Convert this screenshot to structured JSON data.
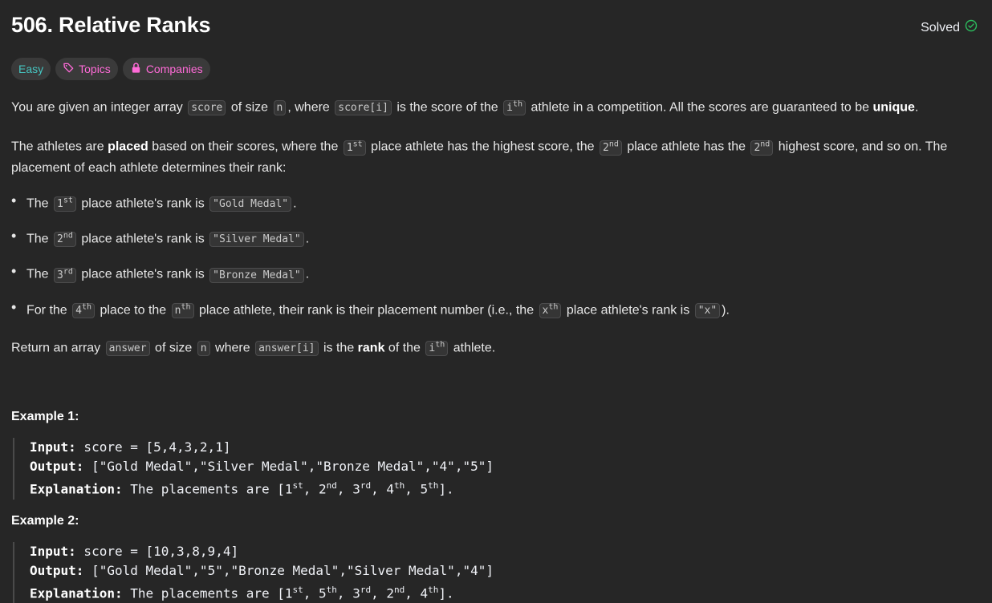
{
  "problem": {
    "title": "506. Relative Ranks",
    "status": "Solved"
  },
  "tags": {
    "difficulty": "Easy",
    "topics": "Topics",
    "companies": "Companies"
  },
  "description": {
    "p1": {
      "a": "You are given an integer array",
      "code1": "score",
      "b": "of size",
      "code2": "n",
      "c": ", where",
      "code3": "score[i]",
      "d": "is the score of the",
      "code4": "i",
      "sup4": "th",
      "e": "athlete in a competition. All the scores are guaranteed to be",
      "bold": "unique",
      "f": "."
    },
    "p2": {
      "a": "The athletes are",
      "bold": "placed",
      "b": "based on their scores, where the",
      "code1": "1",
      "sup1": "st",
      "c": "place athlete has the highest score, the",
      "code2": "2",
      "sup2": "nd",
      "d": "place athlete has the",
      "code3": "2",
      "sup3": "nd",
      "e": "highest score, and so on. The placement of each athlete determines their rank:"
    },
    "bullets": [
      {
        "a": "The",
        "code": "1",
        "sup": "st",
        "b": "place athlete's rank is",
        "code2": "\"Gold Medal\"",
        "c": "."
      },
      {
        "a": "The",
        "code": "2",
        "sup": "nd",
        "b": "place athlete's rank is",
        "code2": "\"Silver Medal\"",
        "c": "."
      },
      {
        "a": "The",
        "code": "3",
        "sup": "rd",
        "b": "place athlete's rank is",
        "code2": "\"Bronze Medal\"",
        "c": "."
      }
    ],
    "bullet4": {
      "a": "For the",
      "code1": "4",
      "sup1": "th",
      "b": "place to the",
      "code2": "n",
      "sup2": "th",
      "c": "place athlete, their rank is their placement number (i.e., the",
      "code3": "x",
      "sup3": "th",
      "d": "place athlete's rank is",
      "code4": "\"x\"",
      "e": ")."
    },
    "p3": {
      "a": "Return an array",
      "code1": "answer",
      "b": "of size",
      "code2": "n",
      "c": "where",
      "code3": "answer[i]",
      "d": "is the",
      "bold": "rank",
      "e": "of the",
      "code4": "i",
      "sup4": "th",
      "f": "athlete."
    }
  },
  "examples": [
    {
      "title": "Example 1:",
      "input_label": "Input:",
      "input": " score = [5,4,3,2,1]",
      "output_label": "Output:",
      "output": " [\"Gold Medal\",\"Silver Medal\",\"Bronze Medal\",\"4\",\"5\"]",
      "expl_label": "Explanation:",
      "expl_pre": " The placements are [1",
      "s1": "st",
      "t1": ", 2",
      "s2": "nd",
      "t2": ", 3",
      "s3": "rd",
      "t3": ", 4",
      "s4": "th",
      "t4": ", 5",
      "s5": "th",
      "t5": "]."
    },
    {
      "title": "Example 2:",
      "input_label": "Input:",
      "input": " score = [10,3,8,9,4]",
      "output_label": "Output:",
      "output": " [\"Gold Medal\",\"5\",\"Bronze Medal\",\"Silver Medal\",\"4\"]",
      "expl_label": "Explanation:",
      "expl_pre": " The placements are [1",
      "s1": "st",
      "t1": ", 5",
      "s2": "th",
      "t2": ", 3",
      "s3": "rd",
      "t3": ", 2",
      "s4": "nd",
      "t4": ", 4",
      "s5": "th",
      "t5": "]."
    }
  ],
  "colors": {
    "background": "#262626",
    "easy": "#46c6c2",
    "accent_pink": "#ff6bd8",
    "solved_check": "#2cbb5d"
  }
}
